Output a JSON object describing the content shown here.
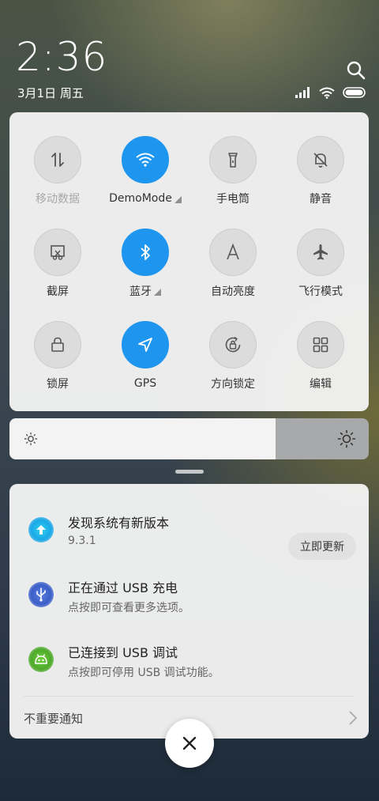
{
  "status": {
    "time": "2:36",
    "date": "3月1日 周五"
  },
  "quick_settings": {
    "tiles": [
      {
        "label": "移动数据",
        "icon": "mobile-data-icon",
        "active": false,
        "disabled": true
      },
      {
        "label": "DemoMode",
        "icon": "wifi-icon",
        "active": true,
        "expandable": true
      },
      {
        "label": "手电筒",
        "icon": "flashlight-icon",
        "active": false
      },
      {
        "label": "静音",
        "icon": "mute-bell-icon",
        "active": false
      },
      {
        "label": "截屏",
        "icon": "screenshot-icon",
        "active": false
      },
      {
        "label": "蓝牙",
        "icon": "bluetooth-icon",
        "active": true,
        "expandable": true
      },
      {
        "label": "自动亮度",
        "icon": "auto-brightness-icon",
        "active": false
      },
      {
        "label": "飞行模式",
        "icon": "airplane-icon",
        "active": false
      },
      {
        "label": "锁屏",
        "icon": "lock-icon",
        "active": false
      },
      {
        "label": "GPS",
        "icon": "gps-icon",
        "active": true
      },
      {
        "label": "方向锁定",
        "icon": "rotation-lock-icon",
        "active": false
      },
      {
        "label": "编辑",
        "icon": "edit-grid-icon",
        "active": false
      }
    ],
    "active_color": "#1e96f0"
  },
  "brightness": {
    "level": 0.74
  },
  "notifications": {
    "items": [
      {
        "title": "发现系统有新版本",
        "subtitle": "9.3.1",
        "icon": "update-arrow-icon",
        "action": "立即更新"
      },
      {
        "title": "正在通过 USB 充电",
        "subtitle": "点按即可查看更多选项。",
        "icon": "usb-icon"
      },
      {
        "title": "已连接到 USB 调试",
        "subtitle": "点按即可停用 USB 调试功能。",
        "icon": "android-debug-icon"
      }
    ],
    "unimportant_label": "不重要通知"
  }
}
